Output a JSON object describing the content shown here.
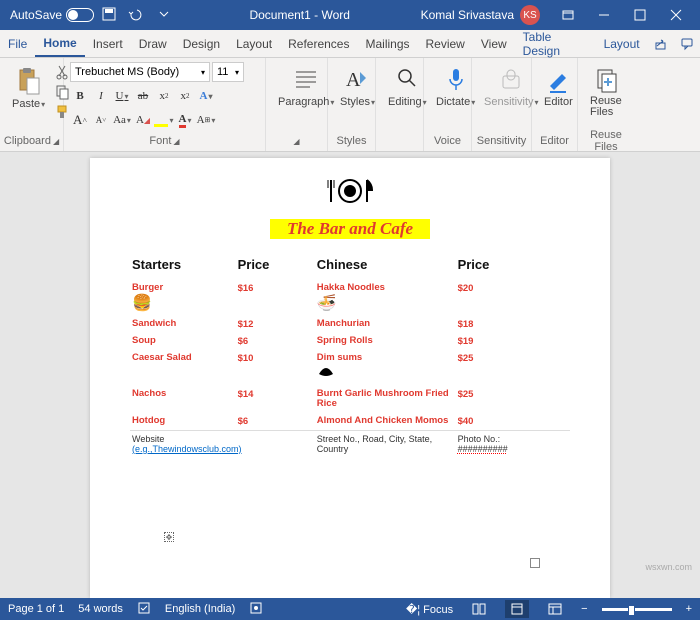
{
  "titlebar": {
    "autosave": "AutoSave",
    "doc": "Document1 - Word",
    "user": "Komal Srivastava",
    "initials": "KS"
  },
  "tabs": {
    "file": "File",
    "home": "Home",
    "insert": "Insert",
    "draw": "Draw",
    "design": "Design",
    "layout": "Layout",
    "references": "References",
    "mailings": "Mailings",
    "review": "Review",
    "view": "View",
    "table_design": "Table Design",
    "layout2": "Layout"
  },
  "ribbon": {
    "paste": "Paste",
    "clipboard": "Clipboard",
    "font_name": "Trebuchet MS (Body)",
    "font_size": "11",
    "font_group": "Font",
    "paragraph": "Paragraph",
    "styles": "Styles",
    "editing": "Editing",
    "dictate": "Dictate",
    "voice": "Voice",
    "sensitivity": "Sensitivity",
    "editor": "Editor",
    "reuse_files": "Reuse\nFiles",
    "reuse_files_grp": "Reuse Files"
  },
  "page": {
    "title": "The Bar and Cafe",
    "col1_header": "Starters",
    "col_price": "Price",
    "col2_header": "Chinese",
    "col1": [
      {
        "name": "Burger",
        "price": "$16",
        "icon": "🍔"
      },
      {
        "name": "Sandwich",
        "price": "$12"
      },
      {
        "name": "Soup",
        "price": "$6"
      },
      {
        "name": "Caesar Salad",
        "price": "$10"
      },
      {
        "name": "Nachos",
        "price": "$14"
      },
      {
        "name": "Hotdog",
        "price": "$6"
      }
    ],
    "col2": [
      {
        "name": "Hakka Noodles",
        "price": "$20",
        "icon": "🍜"
      },
      {
        "name": "Manchurian",
        "price": "$18"
      },
      {
        "name": "Spring Rolls",
        "price": "$19"
      },
      {
        "name": "Dim sums",
        "price": "$25",
        "icon": "⬛"
      },
      {
        "name": "Burnt Garlic Mushroom Fried Rice",
        "price": "$25"
      },
      {
        "name": "Almond And Chicken Momos",
        "price": "$40"
      }
    ],
    "footer": {
      "website_label": "Website",
      "website_hint": "(e.g.,Thewindowsclub.com)",
      "address": "Street No., Road, City, State, Country",
      "photo": "Photo No.:",
      "photo_val": "##########"
    }
  },
  "status": {
    "page": "Page 1 of 1",
    "words": "54 words",
    "lang": "English (India)",
    "focus": "Focus"
  },
  "watermark": "wsxwn.com"
}
